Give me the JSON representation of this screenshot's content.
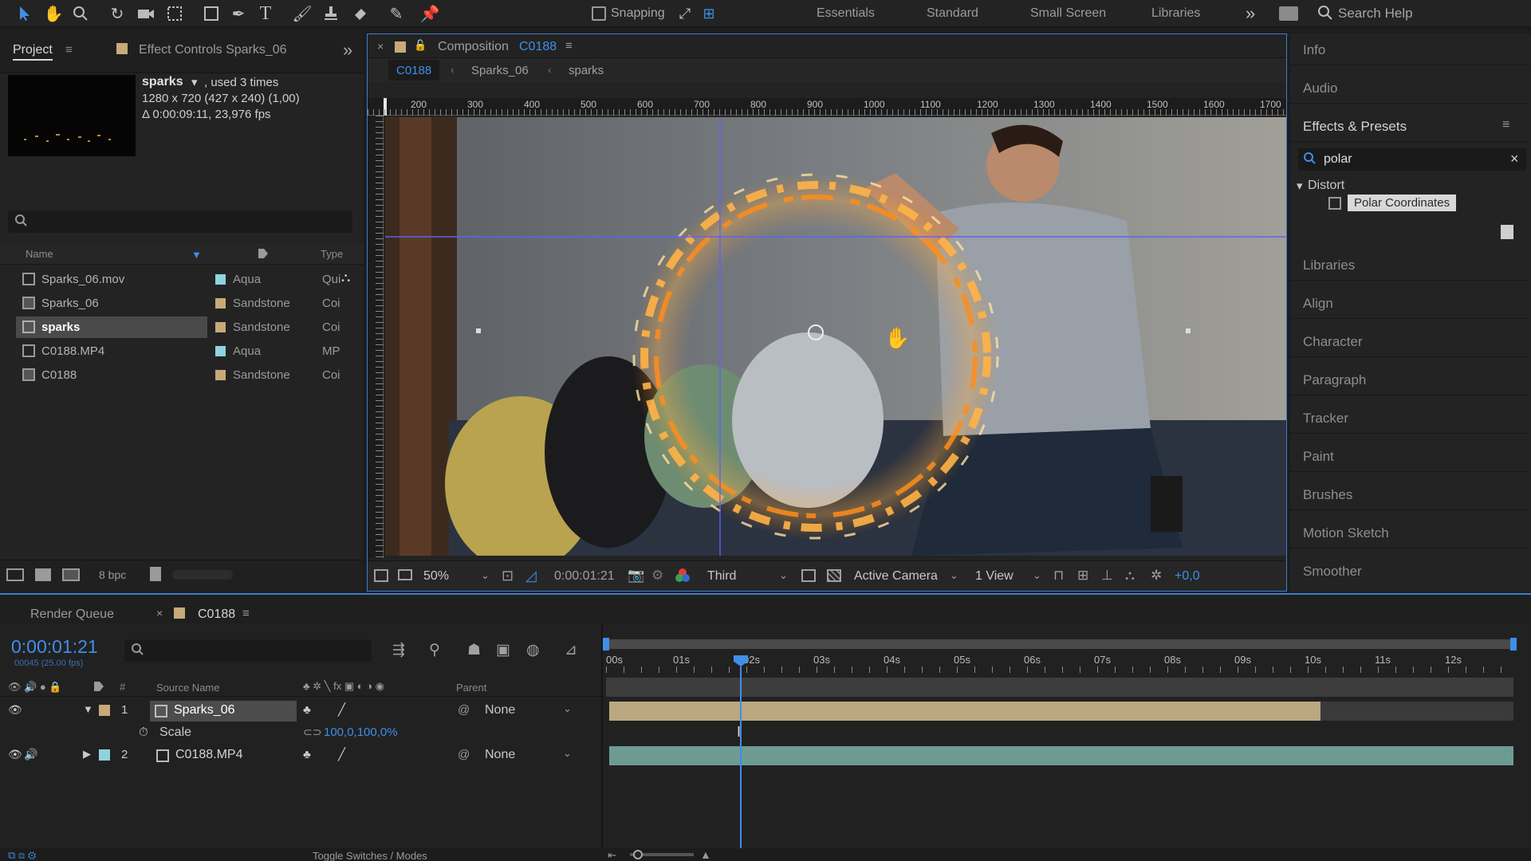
{
  "toolbar": {
    "snapping_label": "Snapping",
    "workspaces": [
      "Essentials",
      "Standard",
      "Small Screen",
      "Libraries"
    ],
    "search_placeholder": "Search Help"
  },
  "project": {
    "tab_project": "Project",
    "tab_effect_controls": "Effect Controls Sparks_06",
    "selected_name": "sparks",
    "selected_used": ", used 3 times",
    "selected_dims": "1280 x 720  (427 x 240) (1,00)",
    "selected_duration": "Δ 0:00:09:11, 23,976 fps",
    "col_name": "Name",
    "col_type": "Type",
    "items": [
      {
        "name": "Sparks_06.mov",
        "label": "Aqua",
        "type": "Qui",
        "color": "#8fd3df"
      },
      {
        "name": "Sparks_06",
        "label": "Sandstone",
        "type": "Coi",
        "color": "#c8a97a"
      },
      {
        "name": "sparks",
        "label": "Sandstone",
        "type": "Coi",
        "color": "#c8a97a"
      },
      {
        "name": "C0188.MP4",
        "label": "Aqua",
        "type": "MP",
        "color": "#8fd3df"
      },
      {
        "name": "C0188",
        "label": "Sandstone",
        "type": "Coi",
        "color": "#c8a97a"
      }
    ],
    "bpc": "8 bpc"
  },
  "composition": {
    "tab_label": "Composition",
    "tab_name": "C0188",
    "crumbs": [
      "C0188",
      "Sparks_06",
      "sparks"
    ],
    "ruler": [
      "200",
      "300",
      "400",
      "500",
      "600",
      "700",
      "800",
      "900",
      "1000",
      "1100",
      "1200",
      "1300",
      "1400",
      "1500",
      "1600",
      "1700"
    ],
    "zoom": "50%",
    "timecode": "0:00:01:21",
    "resolution": "Third",
    "camera": "Active Camera",
    "views": "1 View",
    "exposure": "+0,0"
  },
  "right_panel": {
    "info": "Info",
    "audio": "Audio",
    "effects_title": "Effects & Presets",
    "search_value": "polar",
    "category": "Distort",
    "effect": "Polar Coordinates",
    "items": [
      "Libraries",
      "Align",
      "Character",
      "Paragraph",
      "Tracker",
      "Paint",
      "Brushes",
      "Motion Sketch",
      "Smoother"
    ]
  },
  "timeline": {
    "tab_render_queue": "Render Queue",
    "tab_comp": "C0188",
    "timecode": "0:00:01:21",
    "frames": "00045 (25.00 fps)",
    "col_source": "Source Name",
    "col_parent": "Parent",
    "layers": [
      {
        "num": "1",
        "name": "Sparks_06",
        "parent": "None"
      },
      {
        "num": "2",
        "name": "C0188.MP4",
        "parent": "None"
      }
    ],
    "prop_name": "Scale",
    "prop_value": "100,0,100,0%",
    "ticks": [
      "00s",
      "01s",
      "02s",
      "03s",
      "04s",
      "05s",
      "06s",
      "07s",
      "08s",
      "09s",
      "10s",
      "11s",
      "12s"
    ],
    "bottom_label": "Toggle Switches / Modes"
  },
  "colors": {
    "accent": "#2d8ceb",
    "aqua": "#8fd3df",
    "sandstone": "#c8a97a"
  }
}
